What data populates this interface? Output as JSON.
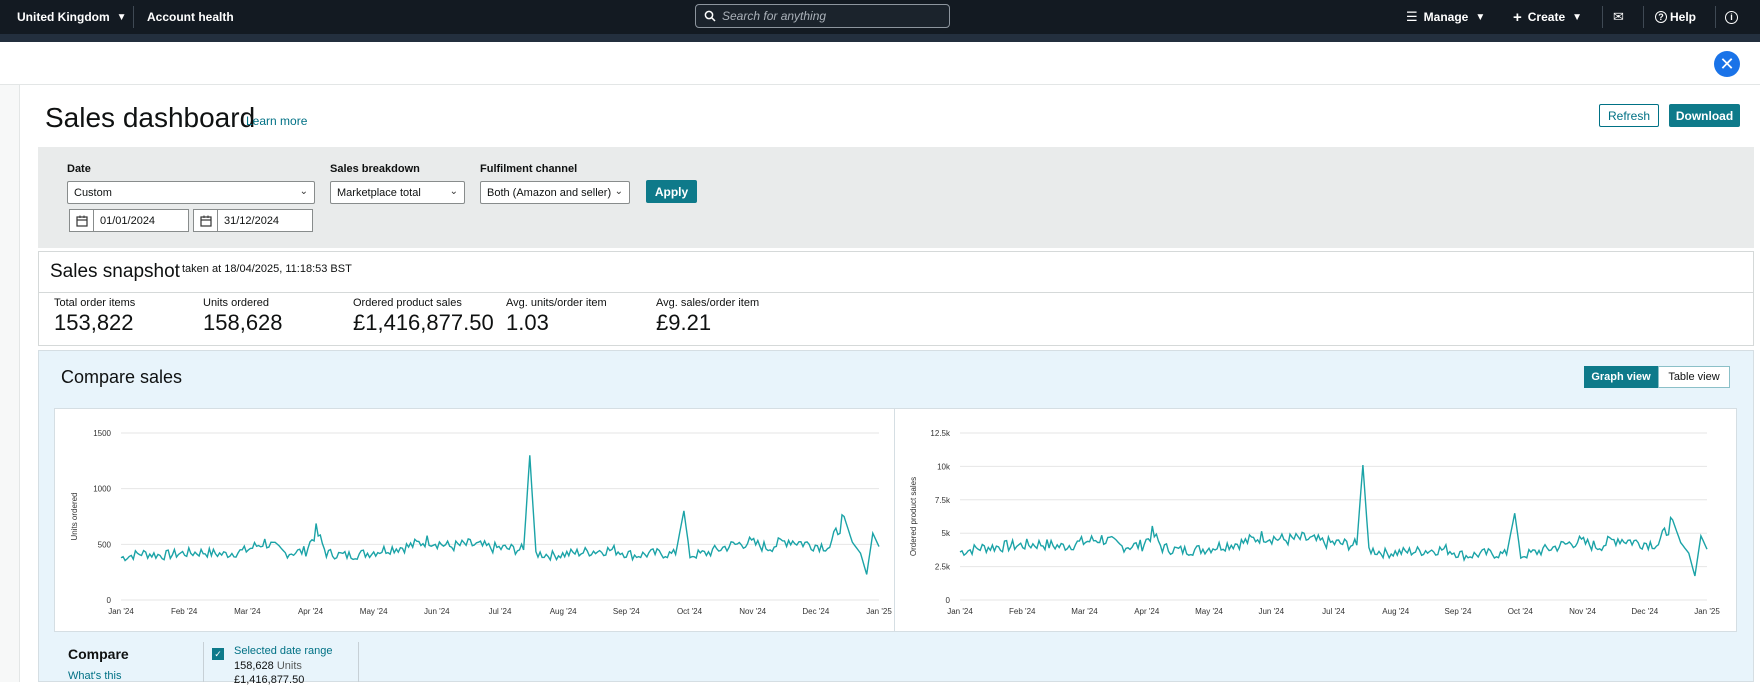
{
  "topbar": {
    "marketplace": "United Kingdom",
    "account_health": "Account health",
    "search_placeholder": "Search for anything",
    "manage": "Manage",
    "create": "Create",
    "help": "Help"
  },
  "header": {
    "title": "Sales dashboard",
    "learn_more": "Learn more",
    "refresh": "Refresh",
    "download": "Download"
  },
  "filters": {
    "date_label": "Date",
    "date_value": "Custom",
    "start_date": "01/01/2024",
    "end_date": "31/12/2024",
    "breakdown_label": "Sales breakdown",
    "breakdown_value": "Marketplace total",
    "channel_label": "Fulfilment channel",
    "channel_value": "Both (Amazon and seller)",
    "apply": "Apply"
  },
  "snapshot": {
    "title": "Sales snapshot",
    "taken_at": "taken at 18/04/2025, 11:18:53 BST",
    "metrics": [
      {
        "label": "Total order items",
        "value": "153,822"
      },
      {
        "label": "Units ordered",
        "value": "158,628"
      },
      {
        "label": "Ordered product sales",
        "value": "£1,416,877.50"
      },
      {
        "label": "Avg. units/order item",
        "value": "1.03"
      },
      {
        "label": "Avg. sales/order item",
        "value": "£9.21"
      }
    ]
  },
  "compare": {
    "title": "Compare sales",
    "graph_view": "Graph view",
    "table_view": "Table view",
    "compare_label": "Compare",
    "whats_this": "What's this",
    "selected_range": "Selected date range",
    "selected_units_value": "158,628",
    "selected_units_suffix": "Units",
    "selected_sales": "£1,416,877.50"
  },
  "colors": {
    "line": "#1ba3a7",
    "accent": "#0e7a8a",
    "link": "#007185",
    "topbar": "#131a22"
  },
  "chart_data": [
    {
      "type": "line",
      "title": "",
      "xlabel": "",
      "ylabel": "Units ordered",
      "ylim": [
        0,
        1500
      ],
      "yticks": [
        "0",
        "500",
        "1000",
        "1500"
      ],
      "xticks": [
        "Jan '24",
        "Feb '24",
        "Mar '24",
        "Apr '24",
        "May '24",
        "Jun '24",
        "Jul '24",
        "Aug '24",
        "Sep '24",
        "Oct '24",
        "Nov '24",
        "Dec '24",
        "Jan '25"
      ],
      "grid": true,
      "anchors": [
        [
          0,
          380
        ],
        [
          10,
          420
        ],
        [
          20,
          400
        ],
        [
          30,
          420
        ],
        [
          40,
          430
        ],
        [
          50,
          410
        ],
        [
          60,
          440
        ],
        [
          70,
          520
        ],
        [
          80,
          420
        ],
        [
          90,
          440
        ],
        [
          95,
          620
        ],
        [
          100,
          420
        ],
        [
          110,
          400
        ],
        [
          120,
          420
        ],
        [
          130,
          460
        ],
        [
          140,
          480
        ],
        [
          150,
          540
        ],
        [
          160,
          480
        ],
        [
          170,
          500
        ],
        [
          180,
          470
        ],
        [
          190,
          460
        ],
        [
          196,
          450
        ],
        [
          199,
          1300
        ],
        [
          202,
          420
        ],
        [
          210,
          400
        ],
        [
          220,
          420
        ],
        [
          230,
          440
        ],
        [
          240,
          450
        ],
        [
          250,
          400
        ],
        [
          260,
          420
        ],
        [
          270,
          410
        ],
        [
          274,
          800
        ],
        [
          277,
          400
        ],
        [
          285,
          420
        ],
        [
          295,
          480
        ],
        [
          305,
          520
        ],
        [
          315,
          470
        ],
        [
          325,
          540
        ],
        [
          335,
          500
        ],
        [
          345,
          480
        ],
        [
          352,
          750
        ],
        [
          356,
          520
        ],
        [
          360,
          420
        ],
        [
          363,
          230
        ],
        [
          366,
          600
        ],
        [
          369,
          480
        ]
      ]
    },
    {
      "type": "line",
      "title": "",
      "xlabel": "",
      "ylabel": "Ordered product sales",
      "ylim": [
        0,
        12500
      ],
      "yticks": [
        "0",
        "2.5k",
        "5k",
        "7.5k",
        "10k",
        "12.5k"
      ],
      "xticks": [
        "Jan '24",
        "Feb '24",
        "Mar '24",
        "Apr '24",
        "May '24",
        "Jun '24",
        "Jul '24",
        "Aug '24",
        "Sep '24",
        "Oct '24",
        "Nov '24",
        "Dec '24",
        "Jan '25"
      ],
      "grid": true,
      "anchors": [
        [
          0,
          3600
        ],
        [
          10,
          3900
        ],
        [
          20,
          4000
        ],
        [
          30,
          4100
        ],
        [
          40,
          4200
        ],
        [
          50,
          4000
        ],
        [
          60,
          4300
        ],
        [
          70,
          4600
        ],
        [
          80,
          4000
        ],
        [
          90,
          4100
        ],
        [
          95,
          5000
        ],
        [
          100,
          3900
        ],
        [
          110,
          3700
        ],
        [
          120,
          3800
        ],
        [
          130,
          4100
        ],
        [
          140,
          4300
        ],
        [
          150,
          4800
        ],
        [
          160,
          4500
        ],
        [
          170,
          4600
        ],
        [
          180,
          4300
        ],
        [
          190,
          4200
        ],
        [
          196,
          4100
        ],
        [
          199,
          10100
        ],
        [
          202,
          3800
        ],
        [
          210,
          3500
        ],
        [
          220,
          3600
        ],
        [
          230,
          3700
        ],
        [
          240,
          3800
        ],
        [
          250,
          3300
        ],
        [
          260,
          3500
        ],
        [
          270,
          3400
        ],
        [
          274,
          6500
        ],
        [
          277,
          3300
        ],
        [
          285,
          3600
        ],
        [
          295,
          4000
        ],
        [
          305,
          4400
        ],
        [
          315,
          4000
        ],
        [
          325,
          4600
        ],
        [
          335,
          4300
        ],
        [
          345,
          4200
        ],
        [
          352,
          6000
        ],
        [
          356,
          4300
        ],
        [
          360,
          3500
        ],
        [
          363,
          1800
        ],
        [
          366,
          4800
        ],
        [
          369,
          3800
        ]
      ]
    }
  ]
}
